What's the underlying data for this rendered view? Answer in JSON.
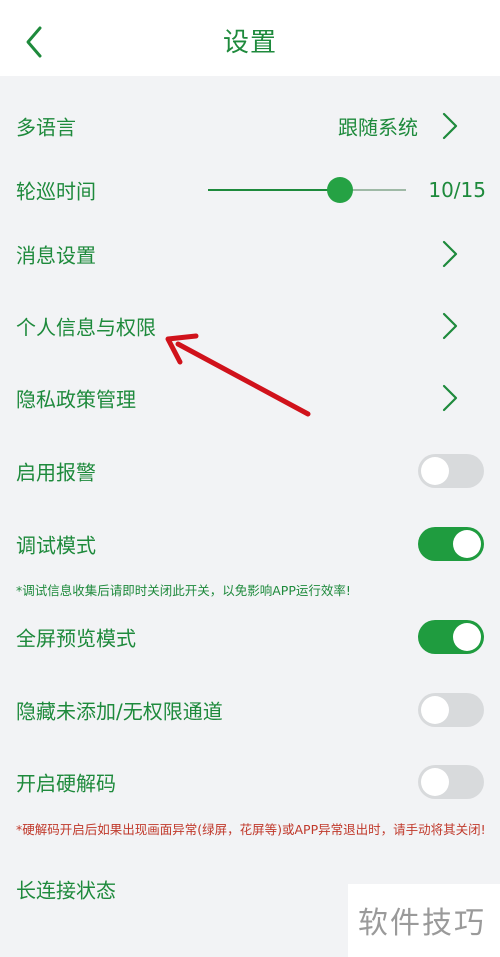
{
  "header": {
    "title": "设置"
  },
  "rows": {
    "language": {
      "label": "多语言",
      "value": "跟随系统"
    },
    "patrol": {
      "label": "轮巡时间",
      "value_text": "10/15",
      "current": 10,
      "max": 15
    },
    "messages": {
      "label": "消息设置"
    },
    "personal": {
      "label": "个人信息与权限"
    },
    "privacy": {
      "label": "隐私政策管理"
    },
    "alarm": {
      "label": "启用报警",
      "enabled": false
    },
    "debug": {
      "label": "调试模式",
      "enabled": true
    },
    "debug_note": "*调试信息收集后请即时关闭此开关，以免影响APP运行效率!",
    "fullscreen": {
      "label": "全屏预览模式",
      "enabled": true
    },
    "hide_channels": {
      "label": "隐藏未添加/无权限通道",
      "enabled": false
    },
    "hw_decode": {
      "label": "开启硬解码",
      "enabled": false
    },
    "hw_note": "*硬解码开启后如果出现画面异常(绿屏，花屏等)或APP异常退出时，请手动将其关闭!",
    "long_conn": {
      "label": "长连接状态"
    }
  },
  "watermark": "软件技巧",
  "colors": {
    "accent": "#1e8a3c",
    "toggle_on": "#1f9c3f",
    "toggle_off": "#d8dadc",
    "warning": "#c0392b",
    "annotation_arrow": "#d0121b"
  },
  "icons": {
    "back": "chevron-left-icon",
    "row": "chevron-right-icon"
  }
}
